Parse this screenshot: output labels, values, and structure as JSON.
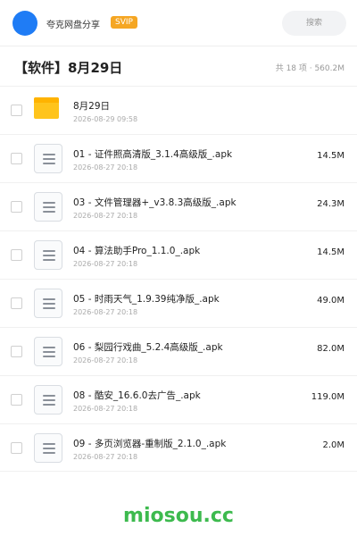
{
  "header": {
    "brand": "夸克网盘分享",
    "badge": "SVIP",
    "search_placeholder": "搜索"
  },
  "folder": {
    "title": "【软件】8月29日",
    "summary": "共 18 项 · 560.2M"
  },
  "files": [
    {
      "name": "8月29日",
      "date": "2026-08-29 09:58",
      "size": "",
      "icon": "folder-icon"
    },
    {
      "name": "01 - 证件照高清版_3.1.4高级版_.apk",
      "date": "2026-08-27 20:18",
      "size": "14.5M",
      "icon": "document-icon"
    },
    {
      "name": "03 - 文件管理器+_v3.8.3高级版_.apk",
      "date": "2026-08-27 20:18",
      "size": "24.3M",
      "icon": "document-icon"
    },
    {
      "name": "04 - 算法助手Pro_1.1.0_.apk",
      "date": "2026-08-27 20:18",
      "size": "14.5M",
      "icon": "document-icon"
    },
    {
      "name": "05 - 时雨天气_1.9.39纯净版_.apk",
      "date": "2026-08-27 20:18",
      "size": "49.0M",
      "icon": "document-icon"
    },
    {
      "name": "06 - 梨园行戏曲_5.2.4高级版_.apk",
      "date": "2026-08-27 20:18",
      "size": "82.0M",
      "icon": "document-icon"
    },
    {
      "name": "08 - 酷安_16.6.0去广告_.apk",
      "date": "2026-08-27 20:18",
      "size": "119.0M",
      "icon": "document-icon"
    },
    {
      "name": "09 - 多页浏览器-重制版_2.1.0_.apk",
      "date": "2026-08-27 20:18",
      "size": "2.0M",
      "icon": "document-icon"
    }
  ],
  "watermark": "miosou.cc",
  "colors": {
    "avatar": "#1f7cf5",
    "badge": "#f5a623",
    "folder": "#ffc41c",
    "watermark": "#3dba4e"
  }
}
